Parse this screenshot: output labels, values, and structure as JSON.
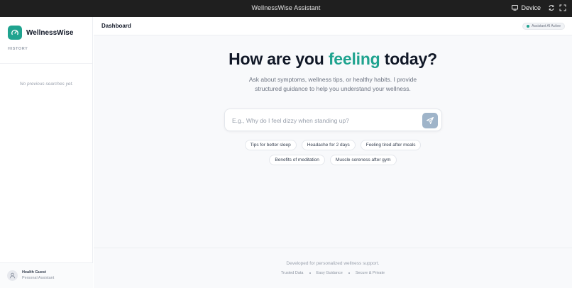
{
  "window": {
    "title": "WellnessWise Assistant",
    "device_label": "Device"
  },
  "sidebar": {
    "brand_name": "WellnessWise",
    "history_label": "HISTORY",
    "history_empty": "No previous searches yet.",
    "user": {
      "name": "Health Guest",
      "role": "Personal Assistant"
    }
  },
  "header": {
    "title": "Dashboard",
    "status": "Assistant AI Active"
  },
  "hero": {
    "title_before": "How are you ",
    "title_accent": "feeling",
    "title_after": " today?",
    "subtitle": "Ask about symptoms, wellness tips, or healthy habits. I provide structured guidance to help you understand your wellness."
  },
  "search": {
    "placeholder": "E.g., Why do I feel dizzy when standing up?",
    "value": ""
  },
  "suggestions": [
    "Tips for better sleep",
    "Headache for 2 days",
    "Feeling tired after meals",
    "Benefits of meditation",
    "Muscle soreness after gym"
  ],
  "footer": {
    "line": "Developed for personalized wellness support.",
    "links": [
      "Trusted Data",
      "Easy Guidance",
      "Secure & Private"
    ]
  },
  "colors": {
    "accent": "#1fa38f",
    "send_button": "#9fb4c9",
    "titlebar": "#1f1f1f"
  },
  "icons": {
    "brand": "gauge-icon",
    "device": "monitor-icon",
    "refresh": "refresh-icon",
    "fullscreen": "fullscreen-icon",
    "send": "send-icon",
    "avatar": "user-icon"
  }
}
